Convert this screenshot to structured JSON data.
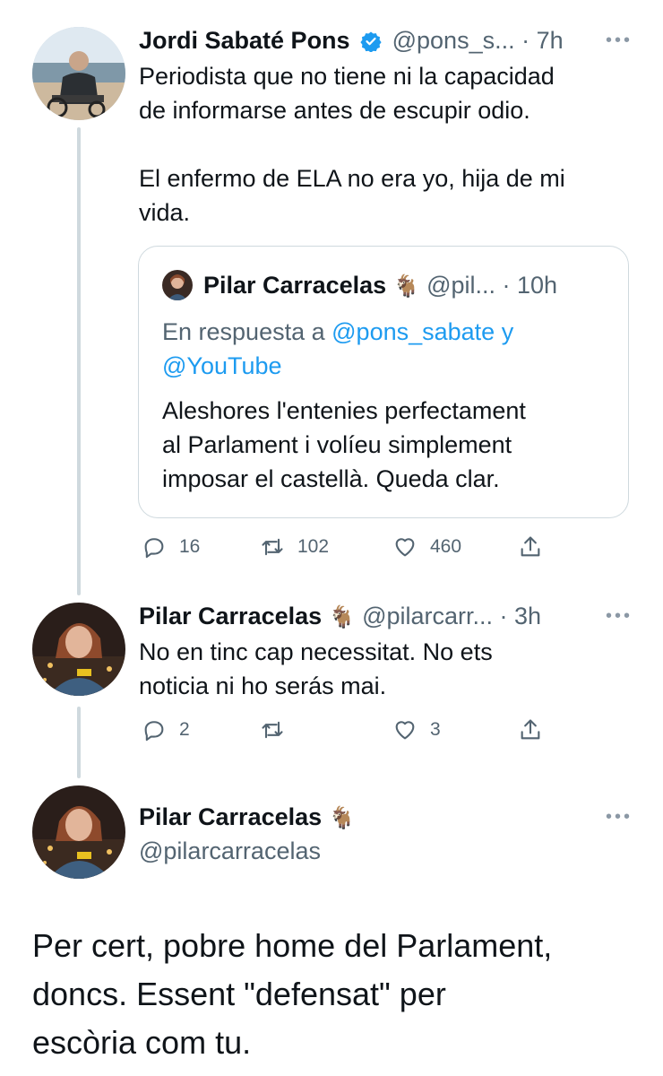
{
  "tweet1": {
    "name": "Jordi Sabaté Pons",
    "handle": "@pons_s...",
    "time": "· 7h",
    "text_line1": "Periodista que no tiene ni la capacidad",
    "text_line2": "de informarse antes de escupir odio.",
    "text_line3": "El enfermo de ELA no era yo, hija de mi",
    "text_line4": "vida.",
    "quote": {
      "name": "Pilar Carracelas",
      "emoji": "🐐",
      "handle": "@pil...",
      "time": "· 10h",
      "reply_prefix": "En respuesta a",
      "reply_to_1": "@pons_sabate",
      "reply_and": "y",
      "reply_to_2": "@YouTube",
      "text_line1": "Aleshores l'entenies perfectament",
      "text_line2": "al Parlament i volíeu simplement",
      "text_line3": "imposar el castellà. Queda clar."
    },
    "replies": "16",
    "retweets": "102",
    "likes": "460"
  },
  "tweet2": {
    "name": "Pilar Carracelas",
    "emoji": "🐐",
    "handle": "@pilarcarr...",
    "time": "· 3h",
    "text_line1": "No en tinc cap necessitat. No ets",
    "text_line2": "noticia ni ho serás mai.",
    "replies": "2",
    "likes": "3"
  },
  "tweet3": {
    "name": "Pilar Carracelas",
    "emoji": "🐐",
    "handle": "@pilarcarracelas",
    "text_line1": "Per cert, pobre home del Parlament,",
    "text_line2": "doncs. Essent \"defensat\" per",
    "text_line3": "escòria com tu."
  },
  "icons": {
    "reply": "reply-icon",
    "retweet": "retweet-icon",
    "like": "heart-icon",
    "share": "share-icon",
    "more": "more-icon",
    "verified": "verified-badge-icon"
  },
  "colors": {
    "link": "#1d9bf0",
    "muted": "#536471",
    "thread_line": "#cfd9de"
  }
}
